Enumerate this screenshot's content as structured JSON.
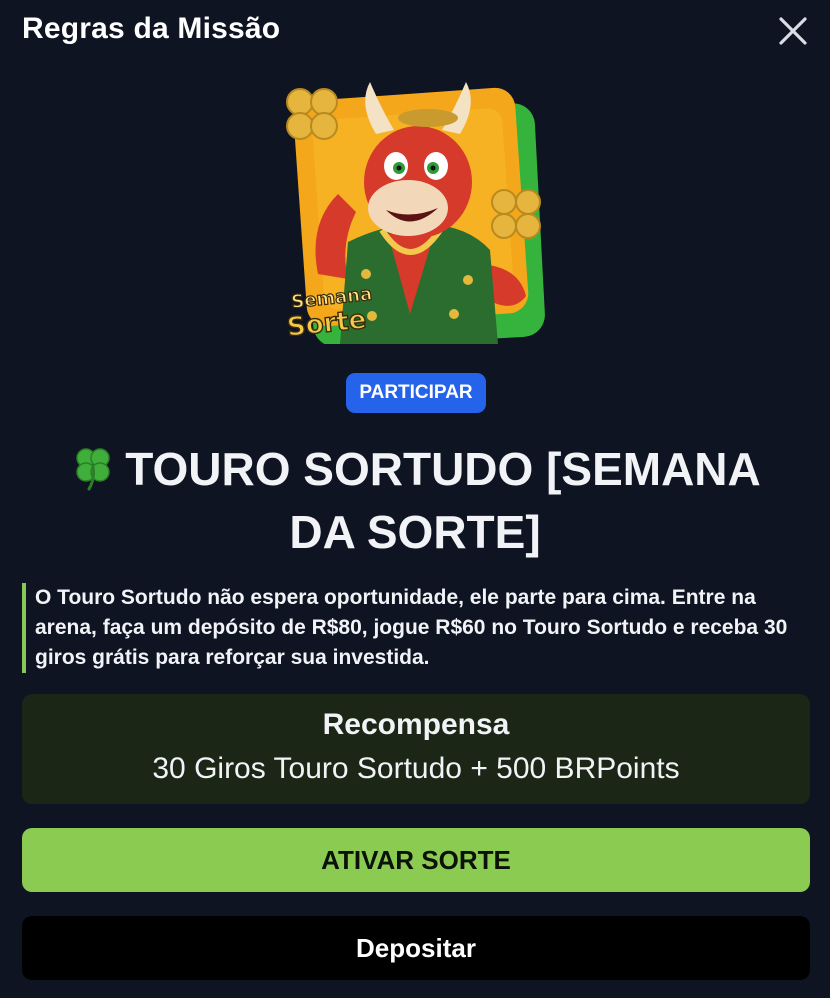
{
  "modal": {
    "title": "Regras da Missão"
  },
  "hero": {
    "logo_text_line1": "Semana",
    "logo_text_line2": "Sorte"
  },
  "badge": {
    "label": "PARTICIPAR",
    "color": "#2563eb"
  },
  "mission": {
    "title": "TOURO SORTUDO [SEMANA DA SORTE]",
    "title_icon": "four-leaf-clover-icon",
    "description": "O Touro Sortudo não espera oportunidade, ele parte para cima. Entre na arena, faça um depósito de R$80, jogue R$60 no Touro Sortudo e receba 30 giros grátis para reforçar sua investida."
  },
  "reward": {
    "heading": "Recompensa",
    "value": "30 Giros Touro Sortudo + 500 BRPoints"
  },
  "actions": {
    "activate_label": "ATIVAR SORTE",
    "activate_color": "#8ccb52",
    "deposit_label": "Depositar"
  },
  "theme": {
    "background": "#0e1422",
    "accent_green": "#86c957"
  }
}
